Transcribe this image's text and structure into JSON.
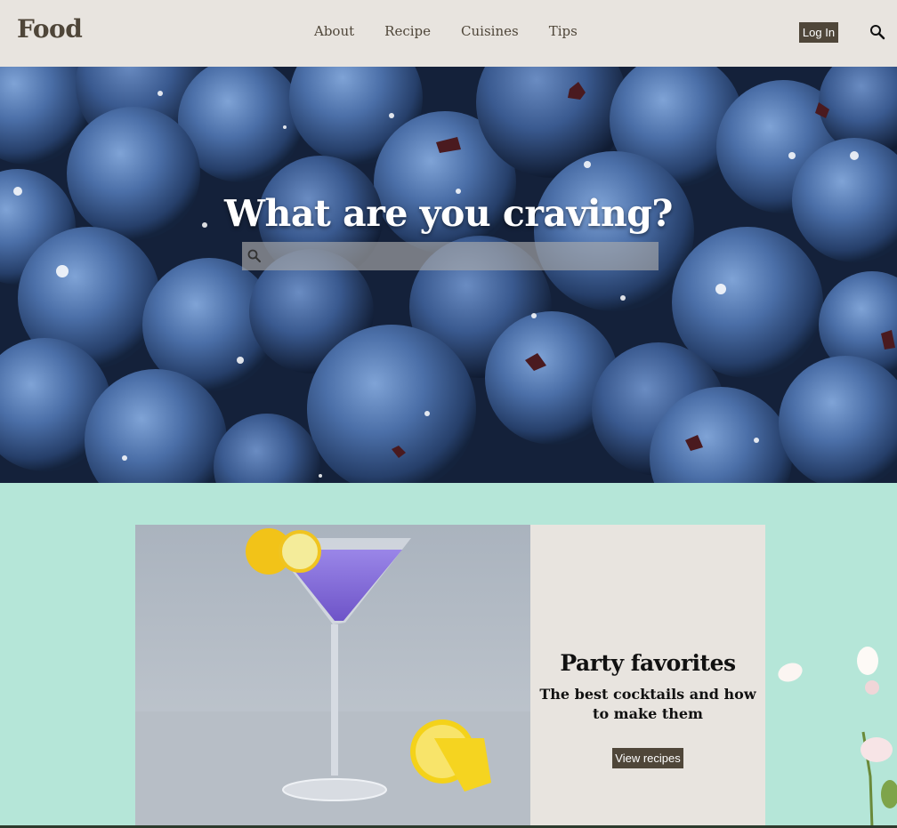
{
  "header": {
    "logo": "Food",
    "nav": [
      "About",
      "Recipe",
      "Cuisines",
      "Tips"
    ],
    "login_label": "Log In",
    "search_icon": "search-icon"
  },
  "hero": {
    "title": "What are you craving?",
    "search_placeholder": "",
    "search_icon": "search-icon",
    "background": "blueberries photo"
  },
  "promo": {
    "image": "purple cocktail with lemon",
    "title": "Party favorites",
    "subtitle": "The best cocktails and how to make them",
    "button_label": "View recipes"
  },
  "colors": {
    "brand": "#4f4639",
    "header_bg": "#e8e4df",
    "promo_bg": "#b5e6d8"
  }
}
